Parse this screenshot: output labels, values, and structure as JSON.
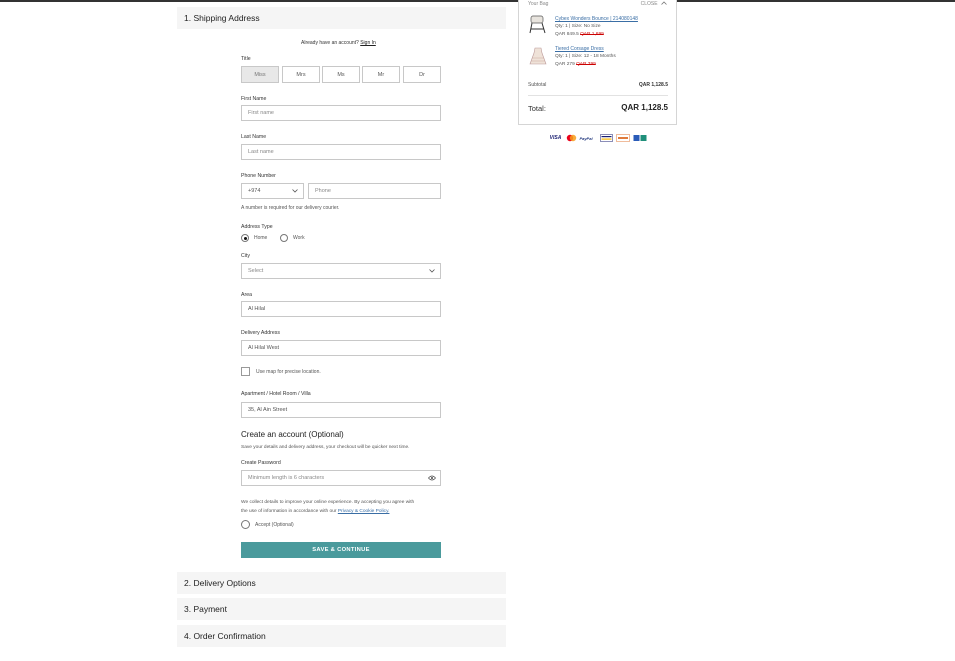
{
  "sections": {
    "shipping": "1. Shipping Address",
    "delivery": "2. Delivery Options",
    "payment": "3. Payment",
    "confirmation": "4. Order Confirmation"
  },
  "account_prompt": {
    "text": "Already have an account?",
    "link": "Sign In"
  },
  "title": {
    "label": "Title",
    "options": [
      "Miss",
      "Mrs",
      "Ms",
      "Mr",
      "Dr"
    ],
    "selected": "Miss"
  },
  "first_name": {
    "label": "First Name",
    "placeholder": "First name"
  },
  "last_name": {
    "label": "Last Name",
    "placeholder": "Last name"
  },
  "phone": {
    "label": "Phone Number",
    "code": "+974",
    "placeholder": "Phone",
    "note": "A number is required for our delivery courier."
  },
  "address_type": {
    "label": "Address Type",
    "home": "Home",
    "work": "Work",
    "selected": "Home"
  },
  "city": {
    "label": "City",
    "value": "Select"
  },
  "area": {
    "label": "Area",
    "value": "Al Hilal"
  },
  "delivery_address": {
    "label": "Delivery Address",
    "value": "Al Hilal West"
  },
  "map_option": {
    "label": "Use map for precise location."
  },
  "apartment": {
    "label": "Apartment / Hotel Room / Villa",
    "value": "35, Al Ain Street"
  },
  "create_account": {
    "heading": "Create an account (Optional)",
    "desc": "Save your details and delivery address, your checkout will be quicker next time.",
    "password_label": "Create Password",
    "password_placeholder": "Minimum length is 6 characters",
    "privacy_line1": "We collect details to improve your online experience. By accepting you agree with",
    "privacy_line2": "the use of information in accordance with our",
    "privacy_link": "Privacy & Cookie Policy.",
    "accept_label": "Accept (Optional)"
  },
  "save_button": "SAVE & CONTINUE",
  "bag": {
    "title": "Your Bag",
    "close": "CLOSE",
    "items": [
      {
        "name": "Cybex Wonders Bounce | 214080148",
        "qty": "Qty: 1",
        "size": "Size: No Size",
        "price": "QAR 849.5",
        "old_price": "QAR 1,699"
      },
      {
        "name": "Tiered Corsage Dress",
        "qty": "Qty: 1",
        "size": "Size: 12 - 18 Months",
        "price": "QAR 279",
        "old_price": "QAR 399"
      }
    ],
    "subtotal_label": "Subtotal",
    "subtotal_value": "QAR 1,128.5",
    "total_label": "Total:",
    "total_value": "QAR 1,128.5"
  },
  "payment_logos": [
    "VISA",
    "mastercard",
    "PayPal",
    "visa-checkout",
    "amex",
    "bank-card"
  ],
  "colors": {
    "primary_button": "#4a9a9c",
    "section_bg": "#f5f5f5",
    "link": "#3a6ea5"
  }
}
